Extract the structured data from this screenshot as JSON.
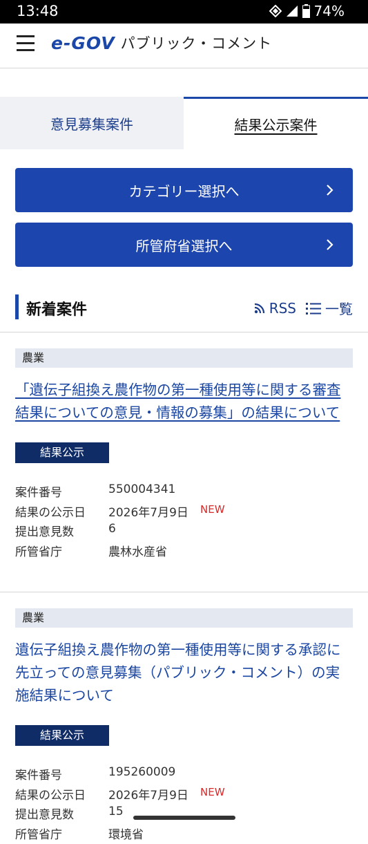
{
  "status_bar": {
    "time": "13:48",
    "battery": "74%"
  },
  "header": {
    "logo": "e-GOV",
    "title": "パブリック・コメント"
  },
  "tabs": [
    {
      "label": "意見募集案件",
      "active": false
    },
    {
      "label": "結果公示案件",
      "active": true
    }
  ],
  "nav_buttons": {
    "category": "カテゴリー選択へ",
    "ministry": "所管府省選択へ"
  },
  "section": {
    "title": "新着案件",
    "rss": "RSS",
    "list": "一覧"
  },
  "cards": [
    {
      "category": "農業",
      "title": "「遺伝子組換え農作物の第一種使用等に関する審査結果についての意見・情報の募集」の結果について",
      "badge": "結果公示",
      "meta": [
        {
          "key": "案件番号",
          "value": "550004341"
        },
        {
          "key": "結果の公示日",
          "value": "2026年7月9日",
          "flag": "NEW"
        },
        {
          "key": "提出意見数",
          "value": "6"
        },
        {
          "key": "所管省庁",
          "value": "農林水産省"
        }
      ]
    },
    {
      "category": "農業",
      "title": "遺伝子組換え農作物の第一種使用等に関する承認に先立っての意見募集（パブリック・コメント）の実施結果について",
      "badge": "結果公示",
      "meta": [
        {
          "key": "案件番号",
          "value": "195260009"
        },
        {
          "key": "結果の公示日",
          "value": "2026年7月9日",
          "flag": "NEW"
        },
        {
          "key": "提出意見数",
          "value": "15"
        },
        {
          "key": "所管省庁",
          "value": "環境省"
        }
      ]
    }
  ],
  "colors": {
    "accent": "#1c45ad",
    "badge": "#102c67",
    "new": "#d62a2a",
    "link": "#1b47a3"
  }
}
